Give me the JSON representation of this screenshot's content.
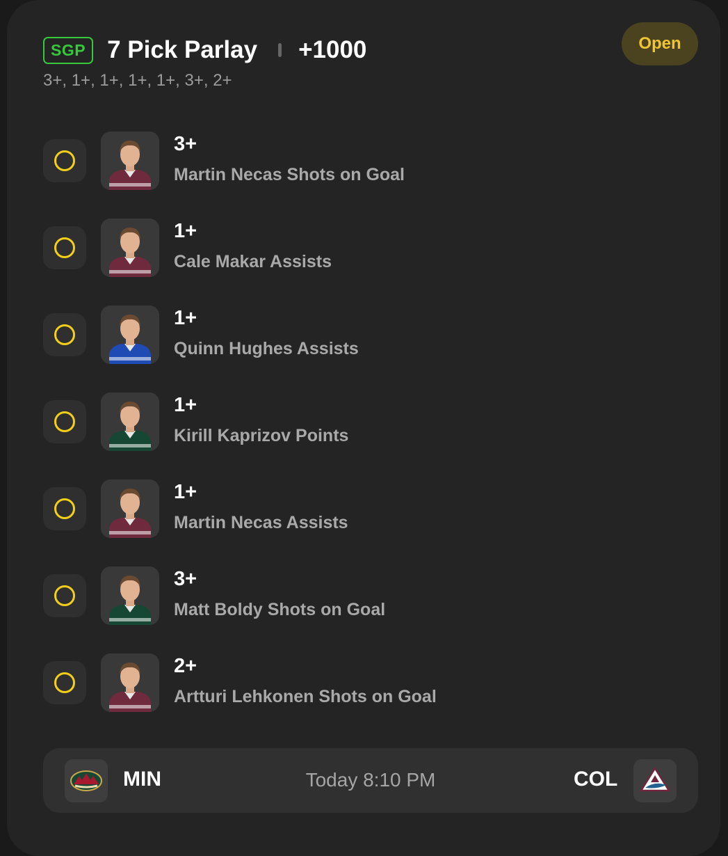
{
  "parlay": {
    "badge": "SGP",
    "title": "7 Pick Parlay",
    "odds": "+1000",
    "lines_summary": "3+, 1+, 1+, 1+, 1+, 3+, 2+",
    "status": "Open"
  },
  "legs": [
    {
      "line": "3+",
      "market": "Martin Necas Shots on Goal",
      "jersey": "#6f2a3e"
    },
    {
      "line": "1+",
      "market": "Cale Makar Assists",
      "jersey": "#6f2a3e"
    },
    {
      "line": "1+",
      "market": "Quinn Hughes Assists",
      "jersey": "#1f4bb4"
    },
    {
      "line": "1+",
      "market": "Kirill Kaprizov Points",
      "jersey": "#154734"
    },
    {
      "line": "1+",
      "market": "Martin Necas Assists",
      "jersey": "#6f2a3e"
    },
    {
      "line": "3+",
      "market": "Matt Boldy Shots on Goal",
      "jersey": "#154734"
    },
    {
      "line": "2+",
      "market": "Artturi Lehkonen Shots on Goal",
      "jersey": "#6f2a3e"
    }
  ],
  "game": {
    "away_team": "MIN",
    "home_team": "COL",
    "time": "Today 8:10 PM",
    "away_logo": "wild-logo-icon",
    "home_logo": "avalanche-logo-icon"
  },
  "colors": {
    "accent_green": "#35c93b",
    "status_yellow": "#f0c52f",
    "radio_yellow": "#f3cf1a"
  }
}
